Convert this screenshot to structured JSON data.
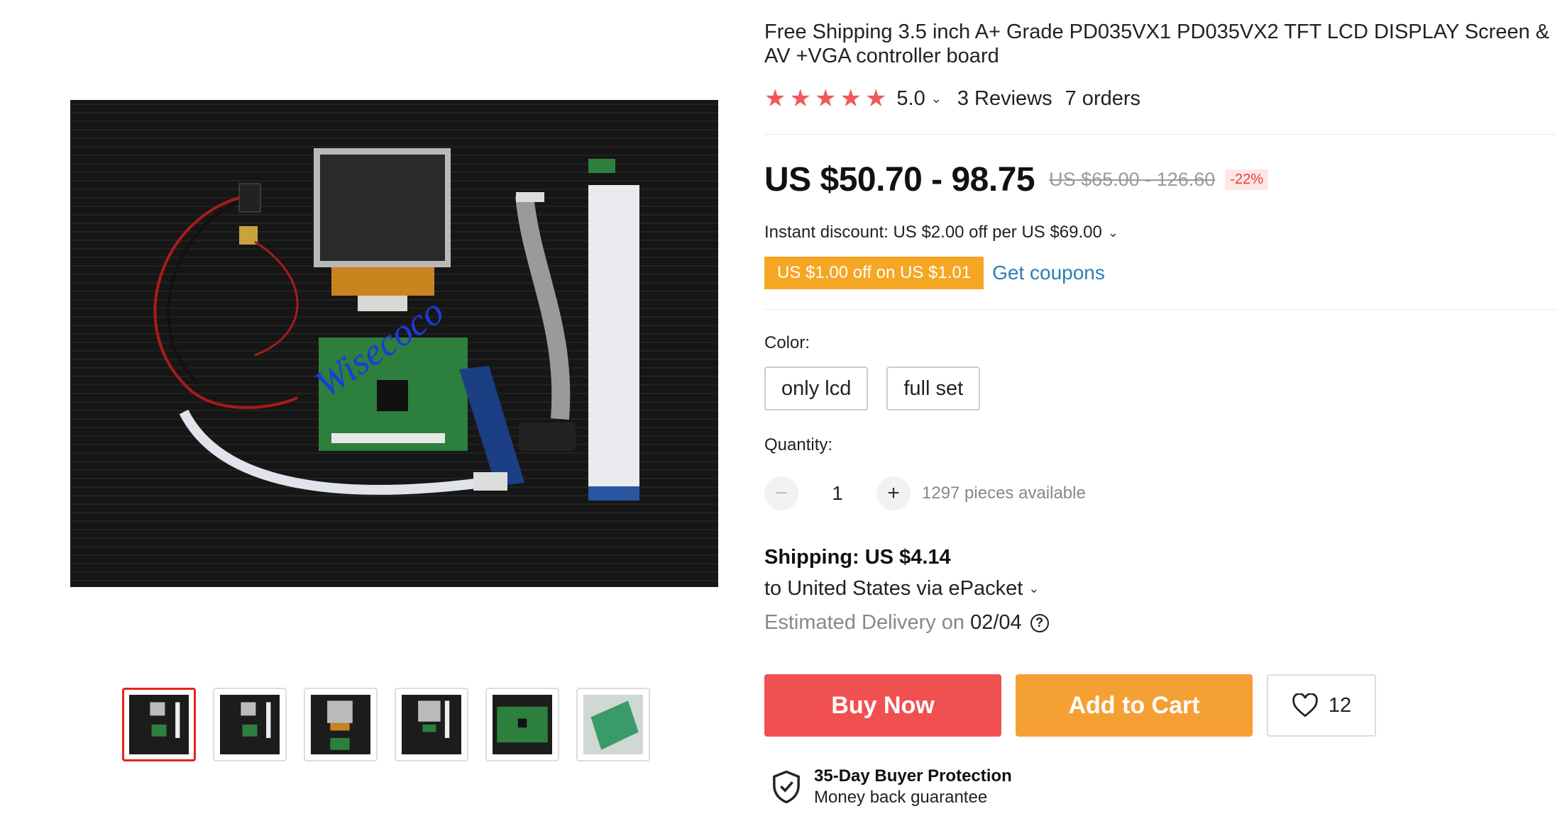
{
  "product": {
    "title": "Free Shipping 3.5 inch A+ Grade PD035VX1 PD035VX2 TFT LCD DISPLAY Screen & AV +VGA controller board",
    "rating": "5.0",
    "reviews": "3 Reviews",
    "orders": "7 orders",
    "star_color": "#f1585c"
  },
  "gallery": {
    "watermark": "Wisecoco",
    "thumb_count": 6,
    "active_index": 0
  },
  "price": {
    "current": "US $50.70 - 98.75",
    "original": "US $65.00 - 126.60",
    "discount": "-22%"
  },
  "promo": {
    "instant_discount": "Instant discount: US $2.00 off per US $69.00",
    "coupon_tag": "US $1.00 off on US $1.01",
    "get_coupons": "Get coupons",
    "coupon_color": "#f5a623"
  },
  "options": {
    "color_label": "Color:",
    "colors": [
      "only lcd",
      "full set"
    ]
  },
  "quantity": {
    "label": "Quantity:",
    "value": "1",
    "minus": "−",
    "plus": "+",
    "available": "1297 pieces available"
  },
  "shipping": {
    "title": "Shipping: US $4.14",
    "to": "to United States via ePacket",
    "est_label": "Estimated Delivery on",
    "est_date": "02/04",
    "help": "?"
  },
  "actions": {
    "buy_now": "Buy Now",
    "add_to_cart": "Add to Cart",
    "wishlist_count": "12",
    "buy_color": "#f05150",
    "cart_color": "#f5a034"
  },
  "protection": {
    "title": "35-Day Buyer Protection",
    "subtitle": "Money back guarantee"
  }
}
